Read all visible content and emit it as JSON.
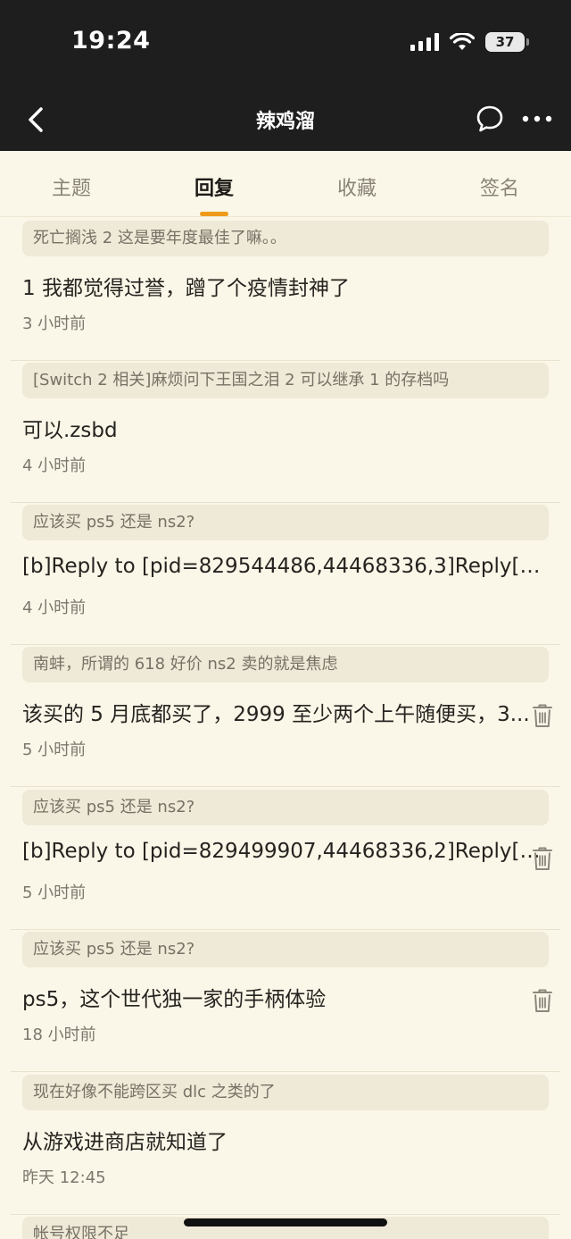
{
  "status_bar": {
    "time": "19:24",
    "battery": "37"
  },
  "nav": {
    "title": "辣鸡溜"
  },
  "tabs": [
    {
      "label": "主题",
      "active": false
    },
    {
      "label": "回复",
      "active": true
    },
    {
      "label": "收藏",
      "active": false
    },
    {
      "label": "签名",
      "active": false
    }
  ],
  "accent_color": "#f09a1c",
  "replies": [
    {
      "quote": "死亡搁浅 2 这是要年度最佳了嘛。。",
      "content": "1 我都觉得过誉，蹭了个疫情封神了",
      "time": "3 小时前",
      "deletable": false
    },
    {
      "quote": "[Switch 2 相关]麻烦问下王国之泪 2 可以继承 1 的存档吗",
      "content": "可以.zsbd",
      "time": "4 小时前",
      "deletable": false
    },
    {
      "quote": "应该买 ps5 还是 ns2?",
      "content": "[b]Reply to [pid=829544486,44468336,3]Reply[/...",
      "time": "4 小时前",
      "deletable": false
    },
    {
      "quote": "南蚌，所谓的 618 好价 ns2 卖的就是焦虑",
      "content": "该买的 5 月底都买了，2999 至少两个上午随便买，3...",
      "time": "5 小时前",
      "deletable": true
    },
    {
      "quote": "应该买 ps5 还是 ns2?",
      "content": "[b]Reply to [pid=829499907,44468336,2]Reply[/...",
      "time": "5 小时前",
      "deletable": true
    },
    {
      "quote": "应该买 ps5 还是 ns2?",
      "content": "ps5，这个世代独一家的手柄体验",
      "time": "18 小时前",
      "deletable": true
    },
    {
      "quote": "现在好像不能跨区买 dlc 之类的了",
      "content": "从游戏进商店就知道了",
      "time": "昨天 12:45",
      "deletable": false
    },
    {
      "quote": "帐号权限不足",
      "content": "",
      "time": "",
      "deletable": false
    }
  ]
}
